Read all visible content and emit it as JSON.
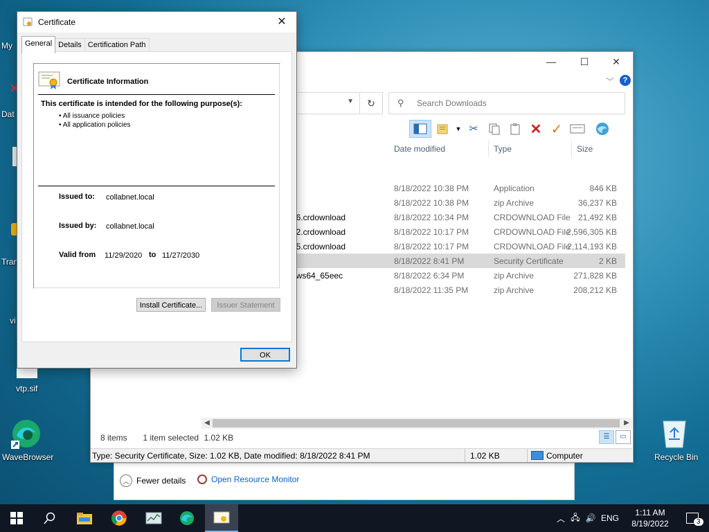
{
  "desktop": {
    "icons": [
      {
        "label": "My"
      },
      {
        "label": "Dat"
      },
      {
        "label": "Tran"
      },
      {
        "label": "vi"
      },
      {
        "label": "vtp.sif"
      },
      {
        "label": "WaveBrowser"
      },
      {
        "label": "Recycle Bin"
      }
    ]
  },
  "taskmanager": {
    "fewer_details": "Fewer details",
    "open_resource_monitor": "Open Resource Monitor"
  },
  "explorer": {
    "address_fragment": "s",
    "search_placeholder": "Search Downloads",
    "columns": {
      "date": "Date modified",
      "type": "Type",
      "size": "Size"
    },
    "files": [
      {
        "name": "",
        "date": "8/18/2022 10:38 PM",
        "type": "Application",
        "size": "846 KB"
      },
      {
        "name": "",
        "date": "8/18/2022 10:38 PM",
        "type": "zip Archive",
        "size": "36,237 KB"
      },
      {
        "name": "36.crdownload",
        "date": "8/18/2022 10:34 PM",
        "type": "CRDOWNLOAD File",
        "size": "21,492 KB"
      },
      {
        "name": "12.crdownload",
        "date": "8/18/2022 10:17 PM",
        "type": "CRDOWNLOAD File",
        "size": "2,596,305 KB"
      },
      {
        "name": "35.crdownload",
        "date": "8/18/2022 10:17 PM",
        "type": "CRDOWNLOAD File",
        "size": "2,114,193 KB"
      },
      {
        "name": "",
        "date": "8/18/2022 8:41 PM",
        "type": "Security Certificate",
        "size": "2 KB",
        "selected": true
      },
      {
        "name": "ows64_65eec",
        "date": "8/18/2022 6:34 PM",
        "type": "zip Archive",
        "size": "271,828 KB"
      },
      {
        "name": "",
        "date": "8/18/2022 11:35 PM",
        "type": "zip Archive",
        "size": "208,212 KB"
      }
    ],
    "status": {
      "items": "8 items",
      "selected": "1 item selected",
      "selected_size": "1.02 KB",
      "details": "Type: Security Certificate, Size: 1.02 KB, Date modified: 8/18/2022 8:41 PM",
      "size2": "1.02 KB",
      "location": "Computer"
    }
  },
  "certificate": {
    "title": "Certificate",
    "tabs": [
      "General",
      "Details",
      "Certification Path"
    ],
    "info_title": "Certificate Information",
    "purpose_heading": "This certificate is intended for the following purpose(s):",
    "policies": [
      "• All issuance policies",
      "• All application policies"
    ],
    "issued_to_label": "Issued to:",
    "issued_to": "collabnet.local",
    "issued_by_label": "Issued by:",
    "issued_by": "collabnet.local",
    "valid_from_label": "Valid from",
    "valid_from": "11/29/2020",
    "to_label": "to",
    "valid_to": "11/27/2030",
    "install_button": "Install Certificate...",
    "issuer_button": "Issuer Statement",
    "ok_button": "OK"
  },
  "taskbar": {
    "lang": "ENG",
    "time": "1:11 AM",
    "date": "8/19/2022",
    "notifications": "3"
  }
}
